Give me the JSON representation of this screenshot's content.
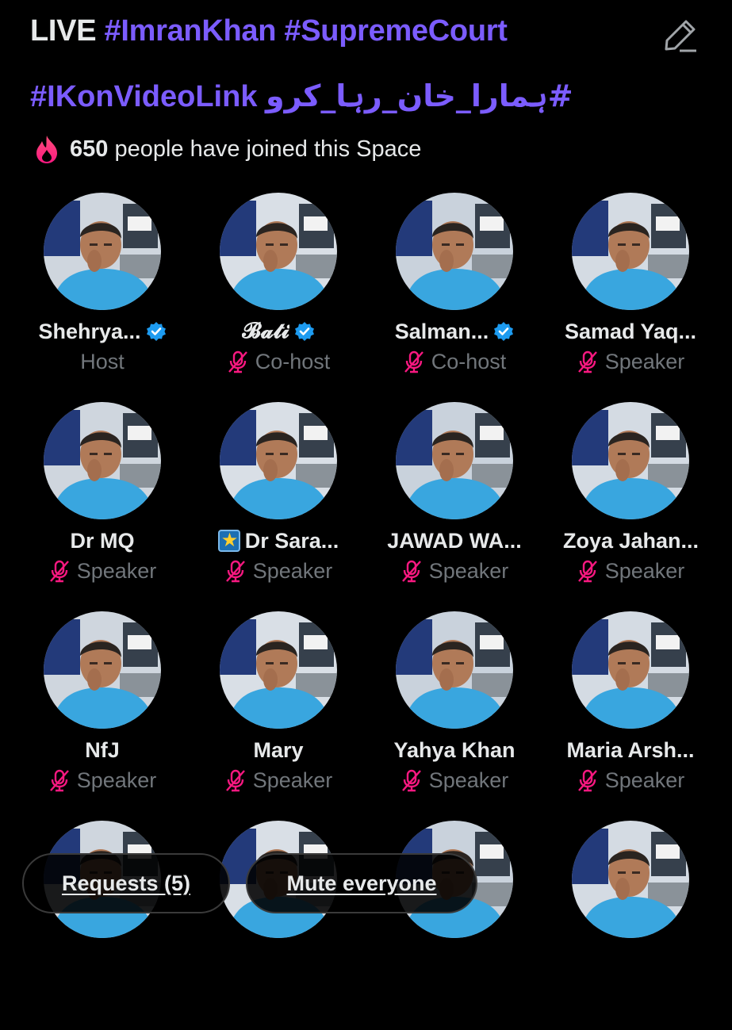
{
  "header": {
    "live_label": "LIVE",
    "hashtag1": "#ImranKhan",
    "hashtag2": "#SupremeCourt",
    "hashtag3": "#IKonVideoLink",
    "hashtag4": "#ہمارا_خان_رہا_کرو",
    "edit_icon": "edit-pencil-icon"
  },
  "joined": {
    "icon": "flame-icon",
    "count": "650",
    "text": "people have joined this Space"
  },
  "participants": [
    {
      "name": "Shehrya...",
      "role": "Host",
      "verified": true,
      "muted": false
    },
    {
      "name": "𝓑𝓪𝓽𝓲",
      "role": "Co-host",
      "verified": true,
      "muted": true
    },
    {
      "name": "Salman...",
      "role": "Co-host",
      "verified": true,
      "muted": true
    },
    {
      "name": "Samad Yaq...",
      "role": "Speaker",
      "verified": false,
      "muted": true
    },
    {
      "name": "Dr MQ",
      "role": "Speaker",
      "verified": false,
      "muted": true
    },
    {
      "name": "Dr Sara...",
      "role": "Speaker",
      "verified": false,
      "muted": true,
      "emoji": "star-emoji"
    },
    {
      "name": "JAWAD WA...",
      "role": "Speaker",
      "verified": false,
      "muted": true
    },
    {
      "name": "Zoya Jahan...",
      "role": "Speaker",
      "verified": false,
      "muted": true
    },
    {
      "name": "NfJ",
      "role": "Speaker",
      "verified": false,
      "muted": true
    },
    {
      "name": "Mary",
      "role": "Speaker",
      "verified": false,
      "muted": true
    },
    {
      "name": "Yahya Khan",
      "role": "Speaker",
      "verified": false,
      "muted": true
    },
    {
      "name": "Maria Arsh...",
      "role": "Speaker",
      "verified": false,
      "muted": true
    },
    {
      "name": "",
      "role": "",
      "verified": false,
      "muted": false
    },
    {
      "name": "",
      "role": "",
      "verified": false,
      "muted": false
    },
    {
      "name": "",
      "role": "",
      "verified": false,
      "muted": false
    },
    {
      "name": "",
      "role": "",
      "verified": false,
      "muted": false
    }
  ],
  "bottom": {
    "requests_label": "Requests (5)",
    "mute_label": "Mute everyone"
  },
  "colors": {
    "background": "#000000",
    "hashtag": "#7b5cff",
    "muted_mic": "#f91880",
    "verified": "#1d9bf0",
    "role_text": "#71767b"
  }
}
